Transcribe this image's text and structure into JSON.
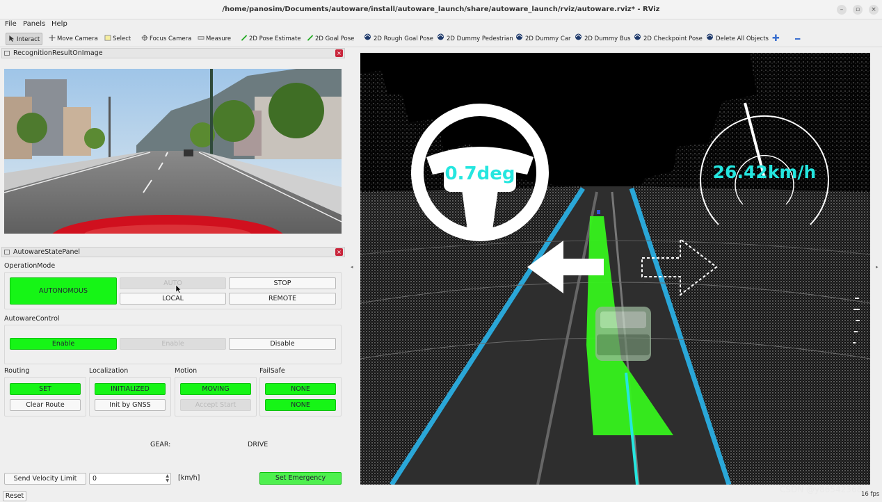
{
  "window": {
    "title": "/home/panosim/Documents/autoware/install/autoware_launch/share/autoware_launch/rviz/autoware.rviz* - RViz"
  },
  "menu": [
    "File",
    "Panels",
    "Help"
  ],
  "toolbar": {
    "interact": "Interact",
    "move_camera": "Move Camera",
    "select": "Select",
    "focus_camera": "Focus Camera",
    "measure": "Measure",
    "pose_estimate": "2D Pose Estimate",
    "goal_pose": "2D Goal Pose",
    "rough_goal_pose": "2D Rough Goal Pose",
    "dummy_pedestrian": "2D Dummy Pedestrian",
    "dummy_car": "2D Dummy Car",
    "dummy_bus": "2D Dummy Bus",
    "checkpoint_pose": "2D Checkpoint Pose",
    "delete_all": "Delete All Objects"
  },
  "recognition_panel": {
    "title": "RecognitionResultOnImage"
  },
  "state_panel": {
    "title": "AutowareStatePanel",
    "operation_mode": {
      "label": "OperationMode",
      "status": "AUTONOMOUS",
      "auto": "AUTO",
      "stop": "STOP",
      "local": "LOCAL",
      "remote": "REMOTE"
    },
    "autoware_control": {
      "label": "AutowareControl",
      "status": "Enable",
      "enable": "Enable",
      "disable": "Disable"
    },
    "routing": {
      "label": "Routing",
      "status": "SET",
      "button": "Clear Route"
    },
    "localization": {
      "label": "Localization",
      "status": "INITIALIZED",
      "button": "Init by GNSS"
    },
    "motion": {
      "label": "Motion",
      "status": "MOVING",
      "button": "Accept Start"
    },
    "failsafe": {
      "label": "FailSafe",
      "status1": "NONE",
      "status2": "NONE"
    },
    "gear": {
      "label": "GEAR:",
      "value": "DRIVE"
    },
    "velocity": {
      "button": "Send Velocity Limit",
      "value": "0",
      "unit": "[km/h]"
    },
    "emergency": "Set Emergency"
  },
  "viewport": {
    "steering": "0.7deg",
    "speed": "26.42km/h",
    "fps": "16 fps"
  },
  "reset": "Reset",
  "watermark": "CSDN @y86542368",
  "colors": {
    "status_green": "#16f516",
    "hud_cyan": "#25e6df",
    "path_green": "#36f21c",
    "lane_blue": "#2aa7d8"
  }
}
